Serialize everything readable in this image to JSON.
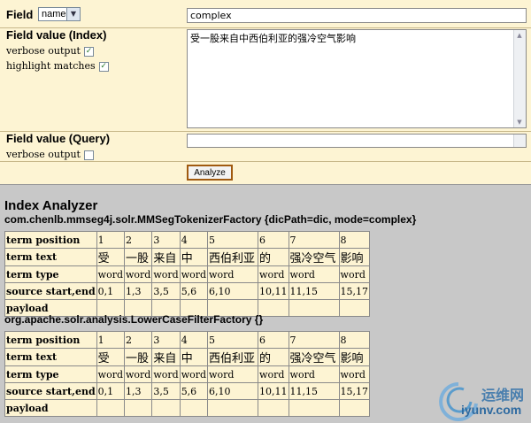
{
  "form": {
    "field_label": "Field",
    "field_select": "name",
    "field_input": "complex",
    "index_label": "Field value (Index)",
    "index_verbose": "verbose output",
    "index_highlight": "highlight matches",
    "index_text": "受一股来自中西伯利亚的强冷空气影响",
    "query_label": "Field value (Query)",
    "query_verbose": "verbose output",
    "query_text": "",
    "analyze_button": "Analyze",
    "checks": {
      "index_verbose": true,
      "index_highlight": true,
      "query_verbose": false
    }
  },
  "analyzer": {
    "title": "Index Analyzer",
    "sections": [
      {
        "heading": "com.chenlb.mmseg4j.solr.MMSegTokenizerFactory {dicPath=dic, mode=complex}",
        "rows": [
          {
            "label": "term position",
            "cells": [
              "1",
              "2",
              "3",
              "4",
              "5",
              "6",
              "7",
              "8"
            ]
          },
          {
            "label": "term text",
            "cells": [
              "受",
              "一股",
              "来自",
              "中",
              "西伯利亚",
              "的",
              "强冷空气",
              "影响"
            ]
          },
          {
            "label": "term type",
            "cells": [
              "word",
              "word",
              "word",
              "word",
              "word",
              "word",
              "word",
              "word"
            ]
          },
          {
            "label": "source start,end",
            "cells": [
              "0,1",
              "1,3",
              "3,5",
              "5,6",
              "6,10",
              "10,11",
              "11,15",
              "15,17"
            ]
          },
          {
            "label": "payload",
            "cells": [
              "",
              "",
              "",
              "",
              "",
              "",
              "",
              ""
            ]
          }
        ]
      },
      {
        "heading": "org.apache.solr.analysis.LowerCaseFilterFactory {}",
        "rows": [
          {
            "label": "term position",
            "cells": [
              "1",
              "2",
              "3",
              "4",
              "5",
              "6",
              "7",
              "8"
            ]
          },
          {
            "label": "term text",
            "cells": [
              "受",
              "一股",
              "来自",
              "中",
              "西伯利亚",
              "的",
              "强冷空气",
              "影响"
            ]
          },
          {
            "label": "term type",
            "cells": [
              "word",
              "word",
              "word",
              "word",
              "word",
              "word",
              "word",
              "word"
            ]
          },
          {
            "label": "source start,end",
            "cells": [
              "0,1",
              "1,3",
              "3,5",
              "5,6",
              "6,10",
              "10,11",
              "11,15",
              "15,17"
            ]
          },
          {
            "label": "payload",
            "cells": [
              "",
              "",
              "",
              "",
              "",
              "",
              "",
              ""
            ]
          }
        ]
      }
    ]
  },
  "watermark": {
    "cn": "运维网",
    "url": "iyunv.com"
  }
}
